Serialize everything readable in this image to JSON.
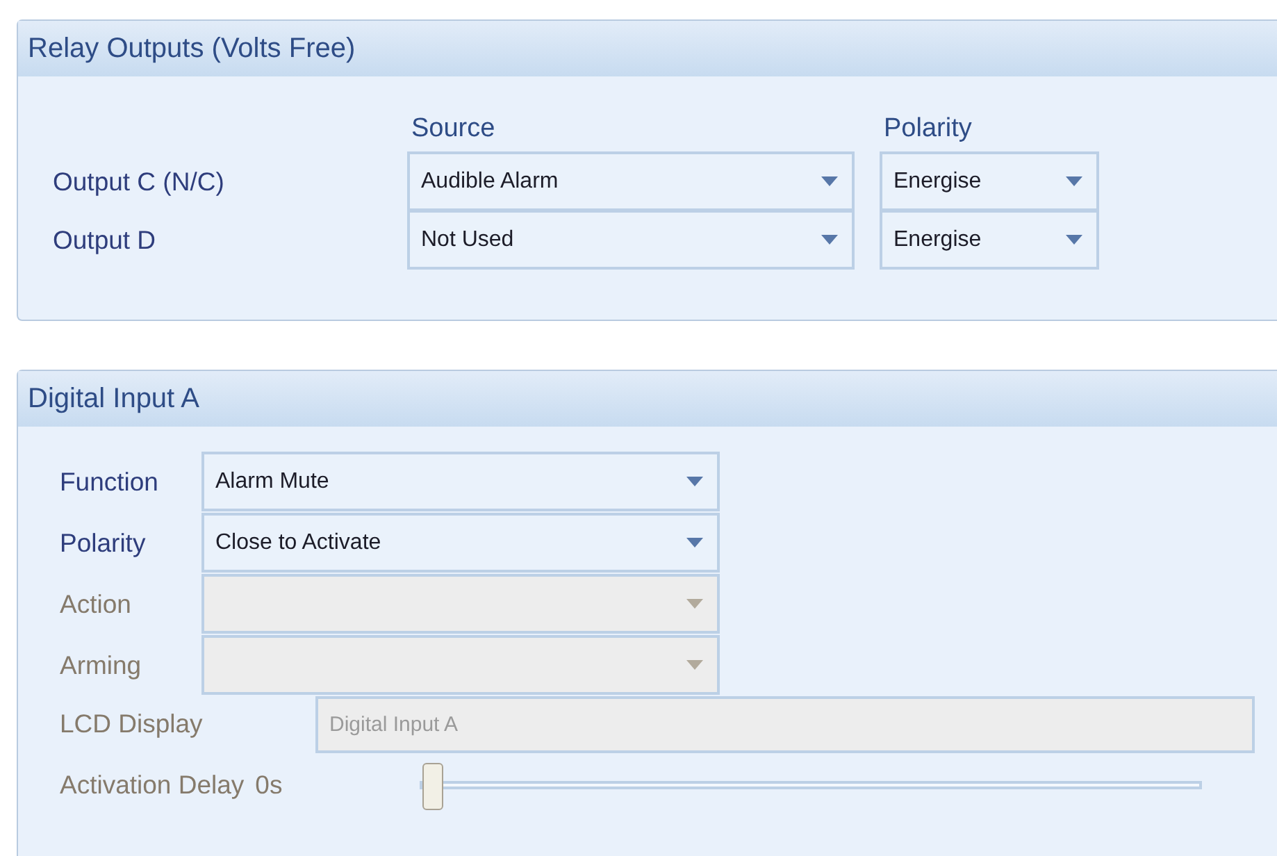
{
  "relay_outputs": {
    "title": "Relay Outputs (Volts Free)",
    "column_headers": [
      "Source",
      "Polarity"
    ],
    "rows": [
      {
        "label": "Output C (N/C)",
        "source": "Audible Alarm",
        "polarity": "Energise"
      },
      {
        "label": "Output D",
        "source": "Not Used",
        "polarity": "Energise"
      }
    ]
  },
  "digital_input": {
    "title": "Digital Input A",
    "fields": [
      {
        "label": "Function",
        "value": "Alarm Mute",
        "disabled": false
      },
      {
        "label": "Polarity",
        "value": "Close to Activate",
        "disabled": false
      },
      {
        "label": "Action",
        "disabled": true
      },
      {
        "label": "Arming",
        "disabled": true
      }
    ],
    "lcd_display": {
      "label": "LCD Display",
      "value": "Digital Input A",
      "disabled": true
    },
    "activation_delay": {
      "label": "Activation Delay",
      "reading": "0s",
      "level": 0,
      "disabled": true
    }
  }
}
